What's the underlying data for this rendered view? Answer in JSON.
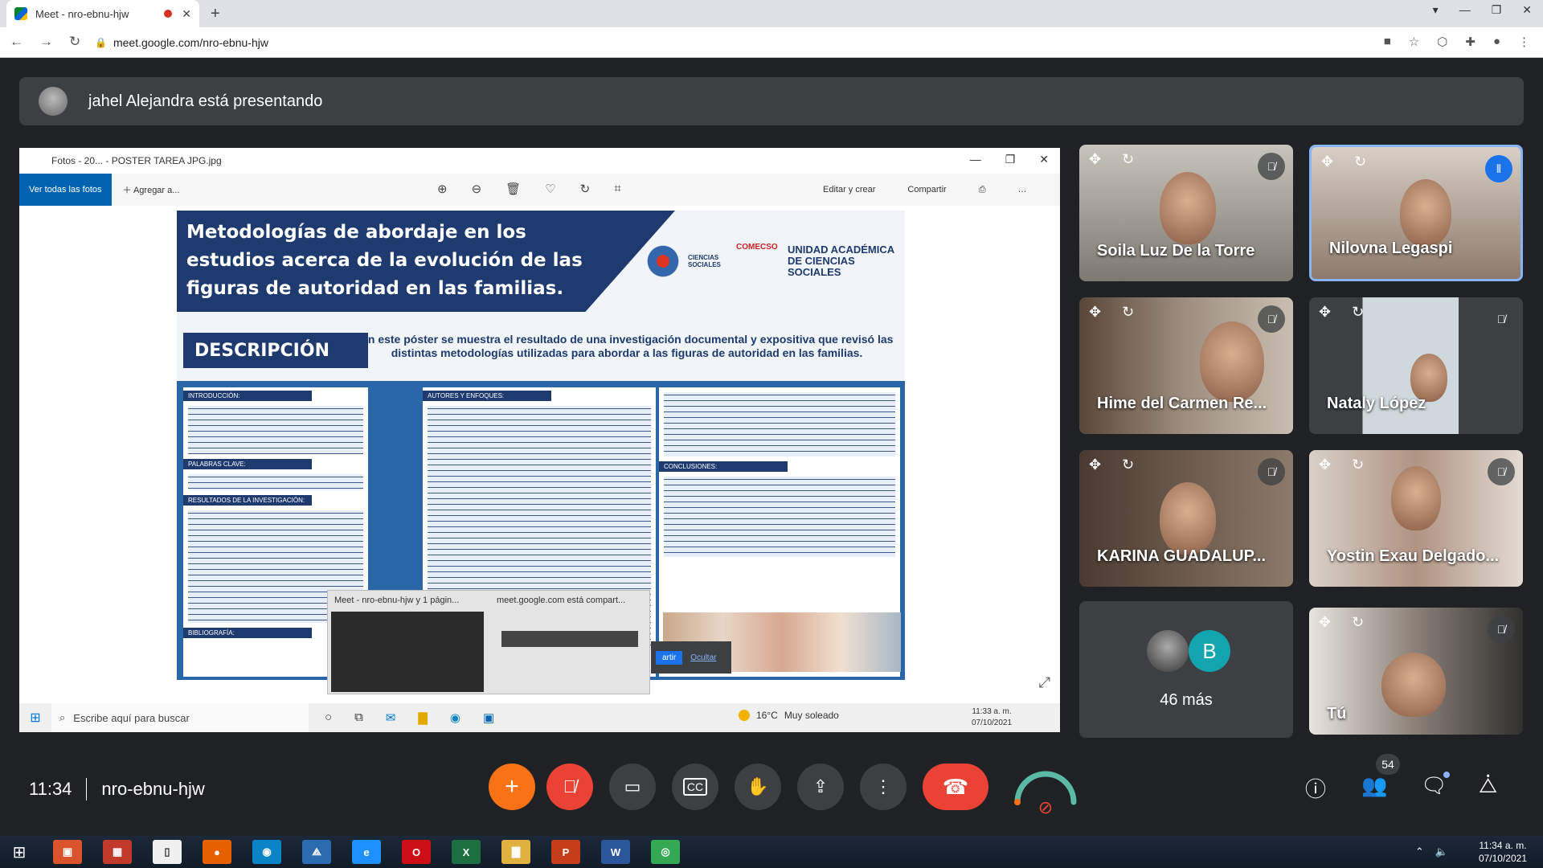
{
  "browser": {
    "tab_title": "Meet - nro-ebnu-hjw",
    "tab_close": "✕",
    "new_tab": "+",
    "url": "meet.google.com/nro-ebnu-hjw"
  },
  "banner": {
    "text": "jahel Alejandra está presentando"
  },
  "photos_app": {
    "window_title": "Fotos - 20... - POSTER TAREA JPG.jpg",
    "see_all": "Ver todas las fotos",
    "add": "Agregar a...",
    "edit": "Editar y crear",
    "share": "Compartir"
  },
  "poster": {
    "title": "Metodologías de abordaje en los estudios acerca de la evolución de las figuras de autoridad en las familias.",
    "logo_comeco": "COMECSO",
    "logo_unit": "UNIDAD ACADÉMICA DE CIENCIAS SOCIALES",
    "logo_week": "CIENCIAS SOCIALES",
    "desc_heading": "DESCRIPCIÓN",
    "desc_text": "En este póster se muestra el resultado de una investigación documental y expositiva que revisó las distintas metodologías utilizadas para abordar a las figuras de autoridad en las familias.",
    "sections": {
      "intro": "INTRODUCCIÓN:",
      "keywords": "PALABRAS CLAVE:",
      "results": "RESULTADOS DE LA INVESTIGACIÓN:",
      "bibliography": "BIBLIOGRAFÍA:",
      "authors": "AUTORES Y ENFOQUES:",
      "conclusions": "CONCLUSIONES:"
    }
  },
  "popup": {
    "item1": "Meet - nro-ebnu-hjw y 1 págin...",
    "item2": "meet.google.com está compart...",
    "btn_share": "artir",
    "btn_hide": "Ocultar"
  },
  "inner_taskbar": {
    "search_placeholder": "Escribe aquí para buscar",
    "weather_temp": "16°C",
    "weather_text": "Muy soleado",
    "time": "11:33 a. m.",
    "date": "07/10/2021"
  },
  "participants": [
    {
      "name": "Soila Luz De la Torre",
      "muted": true,
      "speaking": false
    },
    {
      "name": "Nilovna Legaspi",
      "muted": false,
      "speaking": true
    },
    {
      "name": "Hime del Carmen Re...",
      "muted": true,
      "speaking": false
    },
    {
      "name": "Nataly López",
      "muted": true,
      "speaking": false
    },
    {
      "name": "KARINA GUADALUP...",
      "muted": true,
      "speaking": false
    },
    {
      "name": "Yostin Exau Delgado...",
      "muted": true,
      "speaking": false
    },
    {
      "name": "Tú",
      "muted": true,
      "speaking": false
    }
  ],
  "more_participants": {
    "avatar_letter": "B",
    "label": "46 más"
  },
  "meeting": {
    "time": "11:34",
    "code": "nro-ebnu-hjw",
    "people_count": "54"
  },
  "host_taskbar": {
    "time": "11:34 a. m.",
    "date": "07/10/2021"
  },
  "colors": {
    "meet_bg": "#202124",
    "tile_bg": "#3c4043",
    "red": "#ea4335",
    "speaking_border": "#8ab4f8",
    "poster_navy": "#1e3a6e"
  }
}
